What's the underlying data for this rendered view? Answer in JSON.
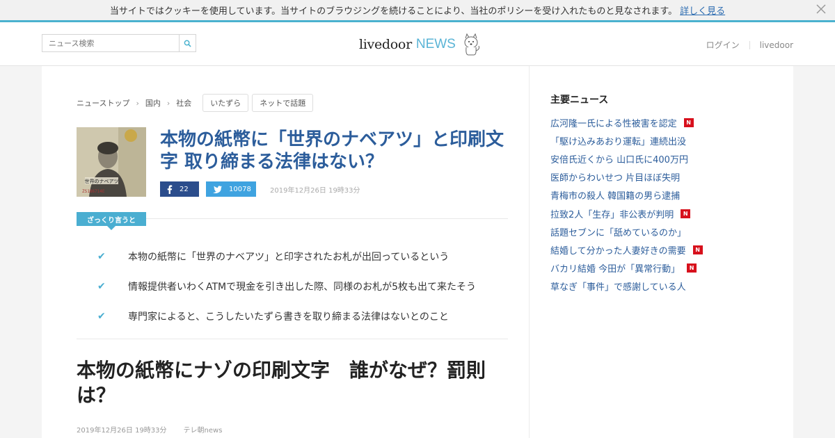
{
  "cookie": {
    "message": "当サイトではクッキーを使用しています。当サイトのブラウジングを続けることにより、当社のポリシーを受け入れたものと見なされます。",
    "link": "詳しく見る",
    "close_icon": "close-icon"
  },
  "header": {
    "search_placeholder": "ニュース検索",
    "logo_livedoor": "livedoor",
    "logo_news": "NEWS",
    "login": "ログイン",
    "livedoor": "livedoor"
  },
  "breadcrumb": {
    "items": [
      "ニューストップ",
      "国内",
      "社会"
    ],
    "tags": [
      "いたずら",
      "ネットで話題"
    ]
  },
  "article": {
    "thumb_label": "世界のナベアツ",
    "title": "本物の紙幣に「世界のナベアツ」と印刷文字 取り締まる法律はない？",
    "fb_count": "22",
    "tw_count": "10078",
    "date": "2019年12月26日 19時33分",
    "summary_label": "ざっくり言うと",
    "summary": [
      "本物の紙幣に「世界のナベアツ」と印字されたお札が出回っているという",
      "情報提供者いわくATMで現金を引き出した際、同様のお札が5枚も出て来たそう",
      "専門家によると、こうしたいたずら書きを取り締まる法律はないとのこと"
    ],
    "headline2": "本物の紙幣にナゾの印刷文字　誰がなぜ？罰則は？",
    "date2": "2019年12月26日 19時33分",
    "source": "テレ朝news"
  },
  "sidebar": {
    "title": "主要ニュース",
    "items": [
      {
        "text": "広河隆一氏による性被害を認定",
        "new": true
      },
      {
        "text": "「駆け込みあおり運転」連続出没",
        "new": false
      },
      {
        "text": "安倍氏近くから 山口氏に400万円",
        "new": false
      },
      {
        "text": "医師からわいせつ 片目ほぼ失明",
        "new": false
      },
      {
        "text": "青梅市の殺人 韓国籍の男ら逮捕",
        "new": false
      },
      {
        "text": "拉致2人「生存」非公表が判明",
        "new": true
      },
      {
        "text": "話題セブンに「舐めているのか」",
        "new": false
      },
      {
        "text": "結婚して分かった人妻好きの需要",
        "new": true
      },
      {
        "text": "バカリ結婚 今田が「異常行動」",
        "new": true
      },
      {
        "text": "草なぎ「事件」で感謝している人",
        "new": false
      }
    ],
    "new_badge": "N"
  },
  "colors": {
    "accent": "#4ab2cf",
    "link": "#2c5d9b",
    "facebook": "#2b4d8c",
    "twitter": "#3fa3e0",
    "new_badge": "#d7101c"
  }
}
